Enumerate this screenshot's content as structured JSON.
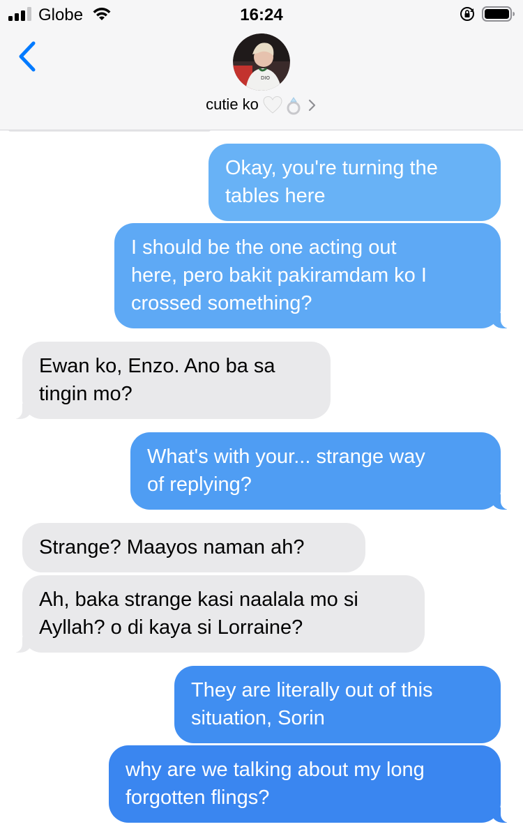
{
  "status_bar": {
    "carrier": "Globe",
    "time": "16:24"
  },
  "header": {
    "contact_name": "cutie ko",
    "contact_emoji": "🤍💍",
    "icons": {
      "back": "chevron-left-icon",
      "details": "chevron-right-icon"
    }
  },
  "colors": {
    "accent": "#007aff",
    "outgoing_top": "#6ab3f7",
    "outgoing_bottom": "#3b86f0",
    "incoming": "#e9e9eb",
    "header_bg": "#f6f6f7"
  },
  "messages": [
    {
      "from": "me",
      "text": "Okay, you're turning the\ntables here"
    },
    {
      "from": "me",
      "text": "I should be the one acting out\nhere, pero bakit pakiramdam ko I\ncrossed something?"
    },
    {
      "from": "them",
      "text": "Ewan ko, Enzo. Ano ba sa\ntingin mo?"
    },
    {
      "from": "me",
      "text": "What's with your... strange way\nof replying?"
    },
    {
      "from": "them",
      "text": "Strange? Maayos naman ah?"
    },
    {
      "from": "them",
      "text": "Ah, baka strange kasi naalala mo si\nAyllah? o di kaya si Lorraine?"
    },
    {
      "from": "me",
      "text": "They are literally out of this\nsituation, Sorin"
    },
    {
      "from": "me",
      "text": "why are we talking about my long\nforgotten flings?"
    }
  ]
}
